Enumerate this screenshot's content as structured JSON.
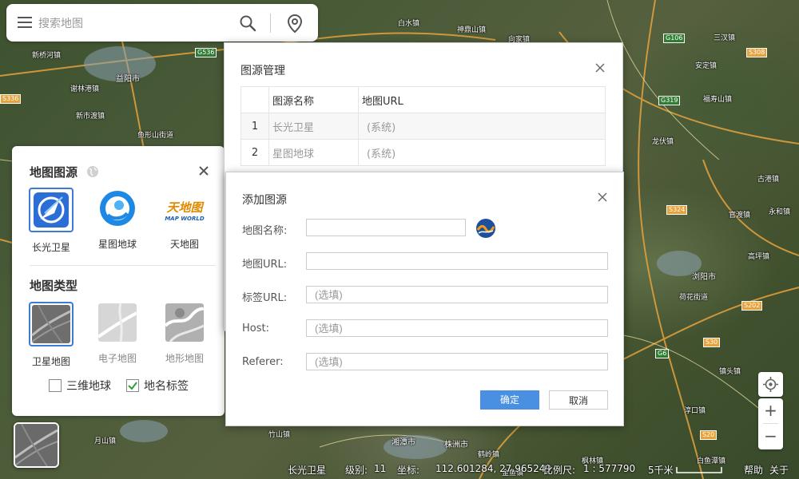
{
  "search": {
    "placeholder": "搜索地图"
  },
  "map_labels": [
    {
      "text": "新桥河镇"
    },
    {
      "text": "益阳市"
    },
    {
      "text": "谢林港镇"
    },
    {
      "text": "新市渡镇"
    },
    {
      "text": "鱼形山街道"
    },
    {
      "text": "白水镇"
    },
    {
      "text": "神鼎山镇"
    },
    {
      "text": "向家镇"
    },
    {
      "text": "三汊镇"
    },
    {
      "text": "安定镇"
    },
    {
      "text": "福寿山镇"
    },
    {
      "text": "龙伏镇"
    },
    {
      "text": "古港镇"
    },
    {
      "text": "官渡镇"
    },
    {
      "text": "永和镇"
    },
    {
      "text": "高坪镇"
    },
    {
      "text": "浏阳市"
    },
    {
      "text": "荷花街道"
    },
    {
      "text": "镇头镇"
    },
    {
      "text": "淳口镇"
    },
    {
      "text": "湘潭市"
    },
    {
      "text": "株洲市"
    },
    {
      "text": "枫林镇"
    },
    {
      "text": "白鱼潭镇"
    },
    {
      "text": "金鱼镇"
    },
    {
      "text": "鹤岭镇"
    },
    {
      "text": "月山镇"
    },
    {
      "text": "竹山镇"
    }
  ],
  "road_badges": [
    "G536",
    "S336",
    "G106",
    "S308",
    "G319",
    "S324",
    "S202",
    "S30",
    "G6",
    "S20"
  ],
  "panel": {
    "source_title": "地图图源",
    "sources": [
      {
        "label": "长光卫星",
        "active": true
      },
      {
        "label": "星图地球",
        "active": false
      },
      {
        "label": "天地图",
        "active": false
      }
    ],
    "tianditu_logo_text": "天地图",
    "tianditu_logo_sub": "MAP WORLD",
    "type_title": "地图类型",
    "types": [
      {
        "label": "卫星地图",
        "active": true
      },
      {
        "label": "电子地图",
        "active": false
      },
      {
        "label": "地形地图",
        "active": false
      }
    ],
    "checkboxes": [
      {
        "label": "三维地球",
        "checked": false
      },
      {
        "label": "地名标签",
        "checked": true
      }
    ]
  },
  "manager": {
    "title": "图源管理",
    "headers": [
      "",
      "图源名称",
      "地图URL"
    ],
    "rows": [
      {
        "index": "1",
        "name": "长光卫星",
        "url": "(系统)"
      },
      {
        "index": "2",
        "name": "星图地球",
        "url": "(系统)"
      }
    ]
  },
  "add_dialog": {
    "title": "添加图源",
    "fields": [
      {
        "label": "地图名称:",
        "placeholder": "",
        "value": ""
      },
      {
        "label": "地图URL:",
        "placeholder": "",
        "value": ""
      },
      {
        "label": "标签URL:",
        "placeholder": "(选填)",
        "value": ""
      },
      {
        "label": "Host:",
        "placeholder": "(选填)",
        "value": ""
      },
      {
        "label": "Referer:",
        "placeholder": "(选填)",
        "value": ""
      }
    ],
    "ok_label": "确定",
    "cancel_label": "取消"
  },
  "controls": {
    "locate_icon": "crosshair-icon",
    "zoom_in": "+",
    "zoom_out": "−"
  },
  "status": {
    "source": "长光卫星",
    "level_label": "级别:",
    "level": "11",
    "coord_label": "坐标:",
    "coord": "112.601284, 27.965249",
    "scale_label": "比例尺:",
    "scale": "1 : 577790",
    "scale_bar": "5千米",
    "help": "帮助",
    "about": "关于"
  },
  "colors": {
    "accent": "#4a90e2",
    "active_border": "#3a7bd5"
  }
}
